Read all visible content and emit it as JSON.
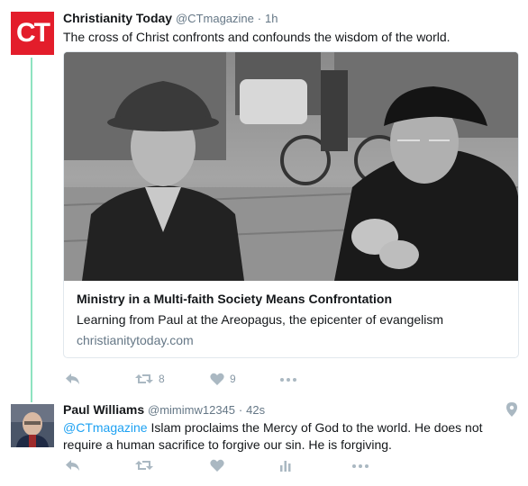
{
  "tweet1": {
    "avatar_text": "CT",
    "name": "Christianity Today",
    "handle": "@CTmagazine",
    "separator": "·",
    "time": "1h",
    "text": "The cross of Christ confronts and confounds the wisdom of the world.",
    "card": {
      "title": "Ministry in a Multi-faith Society Means Confrontation",
      "description": "Learning from Paul at the Areopagus, the epicenter of evangelism",
      "domain": "christianitytoday.com"
    },
    "actions": {
      "retweet_count": "8",
      "like_count": "9"
    }
  },
  "tweet2": {
    "name": "Paul Williams",
    "handle": "@mimimw12345",
    "separator": "·",
    "time": "42s",
    "mention": "@CTmagazine",
    "text_line1": " Islam proclaims the Mercy of God to the world. He does not",
    "text_line2": "require a human sacrifice to forgive our sin. He is forgiving."
  },
  "icons": [
    "reply-icon",
    "retweet-icon",
    "heart-icon",
    "more-icon",
    "analytics-icon",
    "location-pin-icon"
  ],
  "colors": {
    "thread_line": "#8ee3c0",
    "brand_red": "#e31d2b",
    "link": "#1da1f2",
    "muted": "#657786",
    "action_gray": "#aab8c2"
  }
}
